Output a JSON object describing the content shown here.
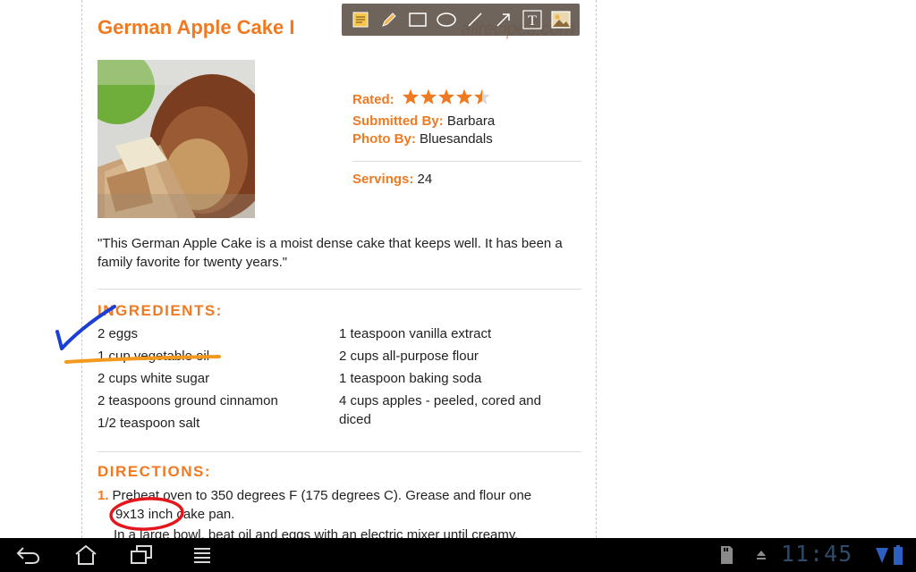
{
  "recipe": {
    "title": "German Apple Cake I",
    "rated_label": "Rated:",
    "rating_stars": 4.5,
    "rating_max": 5,
    "submitted_label": "Submitted By:",
    "submitted_value": "Barbara",
    "photo_label": "Photo By:",
    "photo_value": "Bluesandals",
    "servings_label": "Servings:",
    "servings_value": "24",
    "description": "\"This German Apple Cake is a moist dense cake that keeps well. It has been a family favorite for twenty years.\""
  },
  "ingredients": {
    "heading": "INGREDIENTS:",
    "left": [
      "2 eggs",
      "1 cup vegetable oil",
      "2 cups white sugar",
      "2 teaspoons ground cinnamon",
      "1/2 teaspoon salt"
    ],
    "right": [
      "1 teaspoon vanilla extract",
      "2 cups all-purpose flour",
      "1 teaspoon baking soda",
      "4 cups apples - peeled, cored and diced"
    ]
  },
  "directions": {
    "heading": "DIRECTIONS:",
    "step1_num": "1.",
    "step1_line1": "Preheat oven to 350 degrees F (175 degrees C). Grease and flour one",
    "step1_line2": "9x13 inch cake pan.",
    "step2_partial": "In a large bowl, beat oil and eggs with an electric mixer until creamy."
  },
  "watermark": "allrecipes.com",
  "toolbar": {
    "tools": [
      "note-icon",
      "pencil-icon",
      "rectangle-icon",
      "ellipse-icon",
      "line-icon",
      "arrow-icon",
      "text-icon",
      "image-icon"
    ]
  },
  "status_bar": {
    "time": "11:45"
  },
  "nav": [
    "back-icon",
    "home-icon",
    "recent-apps-icon",
    "menu-icon"
  ],
  "colors": {
    "accent": "#f07a22",
    "annotation_blue": "#1a3fd6",
    "annotation_orange": "#f39a1e",
    "annotation_red": "#e4161c",
    "clock": "#2f4a66",
    "battery": "#2d5fbf"
  }
}
